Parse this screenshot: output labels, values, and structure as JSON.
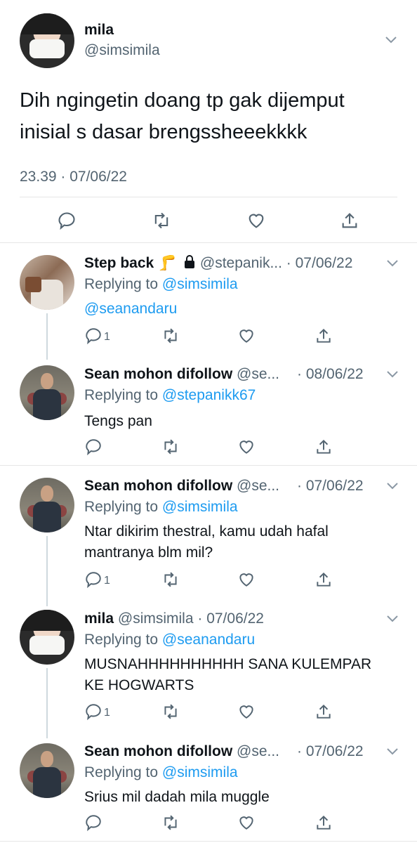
{
  "main_tweet": {
    "name": "mila",
    "handle": "@simsimila",
    "text_line1": "Dih ngingetin doang tp gak dijemput",
    "text_line2": "inisial s dasar brengssheeekkkk",
    "time": "23.39 · 07/06/22"
  },
  "replies": [
    {
      "name": "Step back",
      "emoji": "🦵",
      "handle": "@stepanik...",
      "date": "· 07/06/22",
      "replying_prefix": "Replying to",
      "replying_to": "@simsimila",
      "replying_to2": "@seanandaru",
      "text": "",
      "reply_count": "1"
    },
    {
      "name": "Sean mohon difollow",
      "handle": "@se...",
      "date": "· 08/06/22",
      "replying_prefix": "Replying to",
      "replying_to": "@stepanikk67",
      "text": "Tengs pan",
      "reply_count": ""
    },
    {
      "name": "Sean mohon difollow",
      "handle": "@se...",
      "date": "· 07/06/22",
      "replying_prefix": "Replying to",
      "replying_to": "@simsimila",
      "text_line1": "Ntar dikirim thestral, kamu udah hafal",
      "text_line2": "mantranya blm mil?",
      "reply_count": "1"
    },
    {
      "name": "mila",
      "handle": "@simsimila",
      "date": "· 07/06/22",
      "replying_prefix": "Replying to",
      "replying_to": "@seanandaru",
      "text_line1": "MUSNAHHHHHHHHHH SANA KULEMPAR",
      "text_line2": "KE HOGWARTS",
      "reply_count": "1"
    },
    {
      "name": "Sean mohon difollow",
      "handle": "@se...",
      "date": "· 07/06/22",
      "replying_prefix": "Replying to",
      "replying_to": "@simsimila",
      "text": "Srius mil dadah mila muggle",
      "reply_count": ""
    }
  ],
  "colors": {
    "link": "#1d9bf0",
    "secondary": "#536471",
    "divider": "#e6e6e6",
    "thread": "#cfd9de"
  },
  "icons": [
    "reply-icon",
    "retweet-icon",
    "like-icon",
    "share-icon",
    "chevron-down-icon",
    "lock-icon"
  ]
}
